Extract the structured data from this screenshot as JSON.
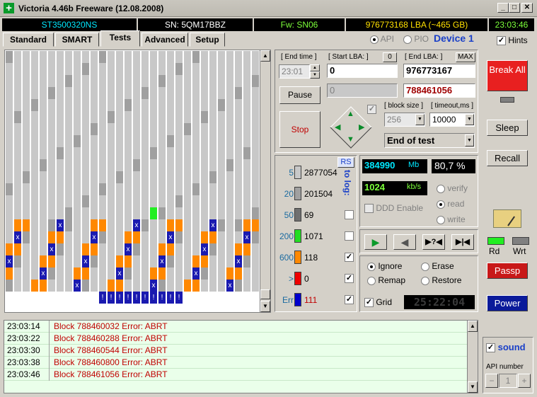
{
  "window": {
    "title": "Victoria 4.46b Freeware (12.08.2008)",
    "min": "_",
    "max": "□",
    "close": "✕"
  },
  "infobar": {
    "model": "ST3500320NS",
    "serial": "SN: 5QM17BBZ",
    "firmware": "Fw: SN06",
    "capacity": "976773168 LBA (~465 GB)",
    "clock": "23:03:46"
  },
  "tabs": [
    "Standard",
    "SMART",
    "Tests",
    "Advanced",
    "Setup"
  ],
  "mode": {
    "api": "API",
    "pio": "PIO",
    "device": "Device 1",
    "hints": "Hints"
  },
  "test": {
    "end_time_label": "[ End time ]",
    "end_time": "23:01",
    "start_lba_label": "[ Start LBA: ]",
    "start_lba_btn": "0",
    "start_lba": "0",
    "cur_lba": "0",
    "end_lba_label": "[ End LBA: ]",
    "end_lba_btn": "MAX",
    "end_lba": "976773167",
    "cur_end": "788461056",
    "pause": "Pause",
    "stop": "Stop",
    "block_size_label": "[ block size ]",
    "block_size": "256",
    "timeout_label": "[ timeout,ms ]",
    "timeout": "10000",
    "end_action": "End of test"
  },
  "stats": {
    "rs": "RS",
    "to_log": "to log:",
    "rows": [
      {
        "ms": "5",
        "count": "2877054",
        "color": "#c8c8c8"
      },
      {
        "ms": "20",
        "count": "201504",
        "color": "#a0a0a0"
      },
      {
        "ms": "50",
        "count": "69",
        "color": "#707070"
      },
      {
        "ms": "200",
        "count": "1071",
        "color": "#22dd22"
      },
      {
        "ms": "600",
        "count": "118",
        "color": "#ff8800"
      },
      {
        "ms": ">",
        "count": "0",
        "color": "#ee0000"
      },
      {
        "ms": "Err",
        "count": "111",
        "color": "#0000cc"
      }
    ]
  },
  "progress": {
    "mb": "384990",
    "mb_unit": "Mb",
    "percent": "80,7 %",
    "speed": "1024",
    "speed_unit": "kb/s",
    "ddd": "DDD Enable",
    "verify": "verify",
    "read": "read",
    "write": "write"
  },
  "actions": {
    "ignore": "Ignore",
    "erase": "Erase",
    "remap": "Remap",
    "restore": "Restore",
    "grid": "Grid",
    "timer": "25:22:04"
  },
  "right": {
    "break": "Break All",
    "sleep": "Sleep",
    "recall": "Recall",
    "rd": "Rd",
    "wrt": "Wrt",
    "passp": "Passp",
    "power": "Power",
    "sound": "sound",
    "api_number": "API number",
    "api_value": "1",
    "minus": "−",
    "plus": "+"
  },
  "log": [
    {
      "time": "23:03:14",
      "msg": "Block 788460032 Error: ABRT"
    },
    {
      "time": "23:03:22",
      "msg": "Block 788460288 Error: ABRT"
    },
    {
      "time": "23:03:30",
      "msg": "Block 788460544 Error: ABRT"
    },
    {
      "time": "23:03:38",
      "msg": "Block 788460800 Error: ABRT"
    },
    {
      "time": "23:03:46",
      "msg": "Block 788461056 Error: ABRT"
    }
  ]
}
